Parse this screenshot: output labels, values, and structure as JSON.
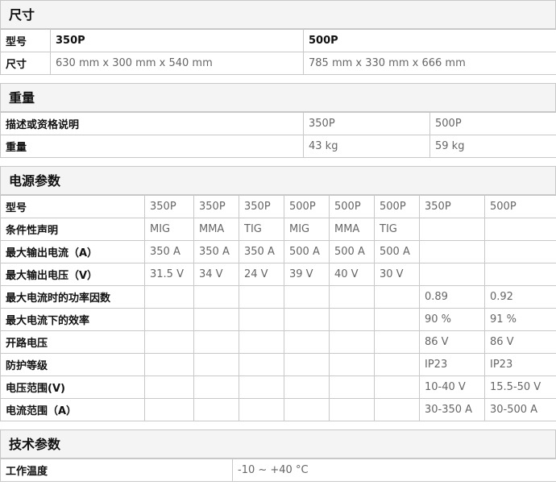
{
  "size": {
    "title": "尺寸",
    "rows": [
      {
        "label": "型号",
        "values": [
          "350P",
          "500P"
        ]
      },
      {
        "label": "尺寸",
        "values": [
          "630 mm x 300 mm x 540 mm",
          "785 mm x 330 mm x 666 mm"
        ]
      }
    ]
  },
  "weight": {
    "title": "重量",
    "rows": [
      {
        "label": "描述或资格说明",
        "values": [
          "350P",
          "500P"
        ]
      },
      {
        "label": "重量",
        "values": [
          "43 kg",
          "59 kg"
        ]
      }
    ]
  },
  "power": {
    "title": "电源参数",
    "rows": [
      {
        "label": "型号",
        "values": [
          "350P",
          "350P",
          "350P",
          "500P",
          "500P",
          "500P",
          "350P",
          "500P"
        ]
      },
      {
        "label": "条件性声明",
        "values": [
          "MIG",
          "MMA",
          "TIG",
          "MIG",
          "MMA",
          "TIG",
          "",
          ""
        ]
      },
      {
        "label": "最大输出电流（A）",
        "values": [
          "350 A",
          "350 A",
          "350 A",
          "500 A",
          "500 A",
          "500 A",
          "",
          ""
        ]
      },
      {
        "label": "最大输出电压（V）",
        "values": [
          "31.5 V",
          "34 V",
          "24 V",
          "39 V",
          "40 V",
          "30 V",
          "",
          ""
        ]
      },
      {
        "label": "最大电流时的功率因数",
        "values": [
          "",
          "",
          "",
          "",
          "",
          "",
          "0.89",
          "0.92"
        ]
      },
      {
        "label": "最大电流下的效率",
        "values": [
          "",
          "",
          "",
          "",
          "",
          "",
          "90 %",
          "91 %"
        ]
      },
      {
        "label": "开路电压",
        "values": [
          "",
          "",
          "",
          "",
          "",
          "",
          "86 V",
          "86 V"
        ]
      },
      {
        "label": "防护等级",
        "values": [
          "",
          "",
          "",
          "",
          "",
          "",
          "IP23",
          "IP23"
        ]
      },
      {
        "label": "电压范围(V)",
        "values": [
          "",
          "",
          "",
          "",
          "",
          "",
          "10-40 V",
          "15.5-50 V"
        ]
      },
      {
        "label": "电流范围（A）",
        "values": [
          "",
          "",
          "",
          "",
          "",
          "",
          "30-350 A",
          "30-500 A"
        ]
      }
    ]
  },
  "tech": {
    "title": "技术参数",
    "rows": [
      {
        "label": "工作温度",
        "values": [
          "-10 ~ +40 °C"
        ]
      }
    ]
  }
}
